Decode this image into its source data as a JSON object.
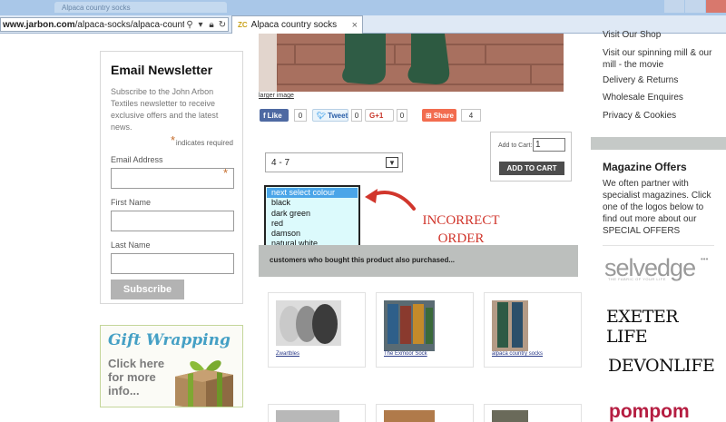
{
  "browser": {
    "url_host": "www.jarbon.com",
    "url_path": "/alpaca-socks/alpaca-country-socks/alp",
    "tab_title": "Alpaca country socks",
    "tab_favicon": "ZC",
    "ghost_tab_title": "Alpaca country socks"
  },
  "newsletter": {
    "title": "Email Newsletter",
    "description": "Subscribe to the John Arbon Textiles newsletter to receive exclusive offers and the latest news.",
    "required_note": "indicates required",
    "required_marker": "*",
    "email_label": "Email Address",
    "first_name_label": "First Name",
    "last_name_label": "Last Name",
    "submit_label": "Subscribe"
  },
  "gift": {
    "title": "Gift Wrapping",
    "cta": "Click here for more info..."
  },
  "product": {
    "larger_image_link": "larger image",
    "size_value": "4 - 7",
    "colour_options": [
      "next select colour",
      "black",
      "dark green",
      "red",
      "damson",
      "natural white"
    ],
    "add_to_cart_label": "Add to Cart:",
    "cart_qty": "1",
    "add_to_cart_button": "ADD TO CART"
  },
  "share": {
    "fb_label": "Like",
    "fb_count": "0",
    "tweet_label": "Tweet",
    "tweet_count": "0",
    "gplus_label": "G+1",
    "gplus_count": "0",
    "share_label": "Share",
    "share_count": "4"
  },
  "annotation": {
    "line1": "INCORRECT",
    "line2": "ORDER",
    "color": "#d1362c"
  },
  "also_purchased": {
    "heading": "customers who bought this product also purchased...",
    "items": [
      "Zwartbles",
      "The Exmoor Sock",
      "alpaca country socks"
    ]
  },
  "sidebar": {
    "links": [
      "Visit Our Shop",
      "Visit our spinning mill & our mill - the movie",
      "Delivery & Returns",
      "Wholesale Enquires",
      "Privacy & Cookies"
    ],
    "mag_title": "Magazine Offers",
    "mag_desc": "We often partner with specialist magazines. Click one of the logos below to find out more about our SPECIAL OFFERS",
    "logos": {
      "selvedge": "selvedge",
      "selvedge_dots": "•••",
      "selvedge_tag": "THE FABRIC OF YOUR LIFE",
      "exeter": "EXETER LIFE",
      "devon": "DEVONLIFE",
      "pompom": "pompom"
    }
  },
  "colors": {
    "chrome": "#a9c7e8",
    "accent_red": "#d1362c",
    "gift_blue": "#45a0c5",
    "pompom": "#b51d41"
  }
}
